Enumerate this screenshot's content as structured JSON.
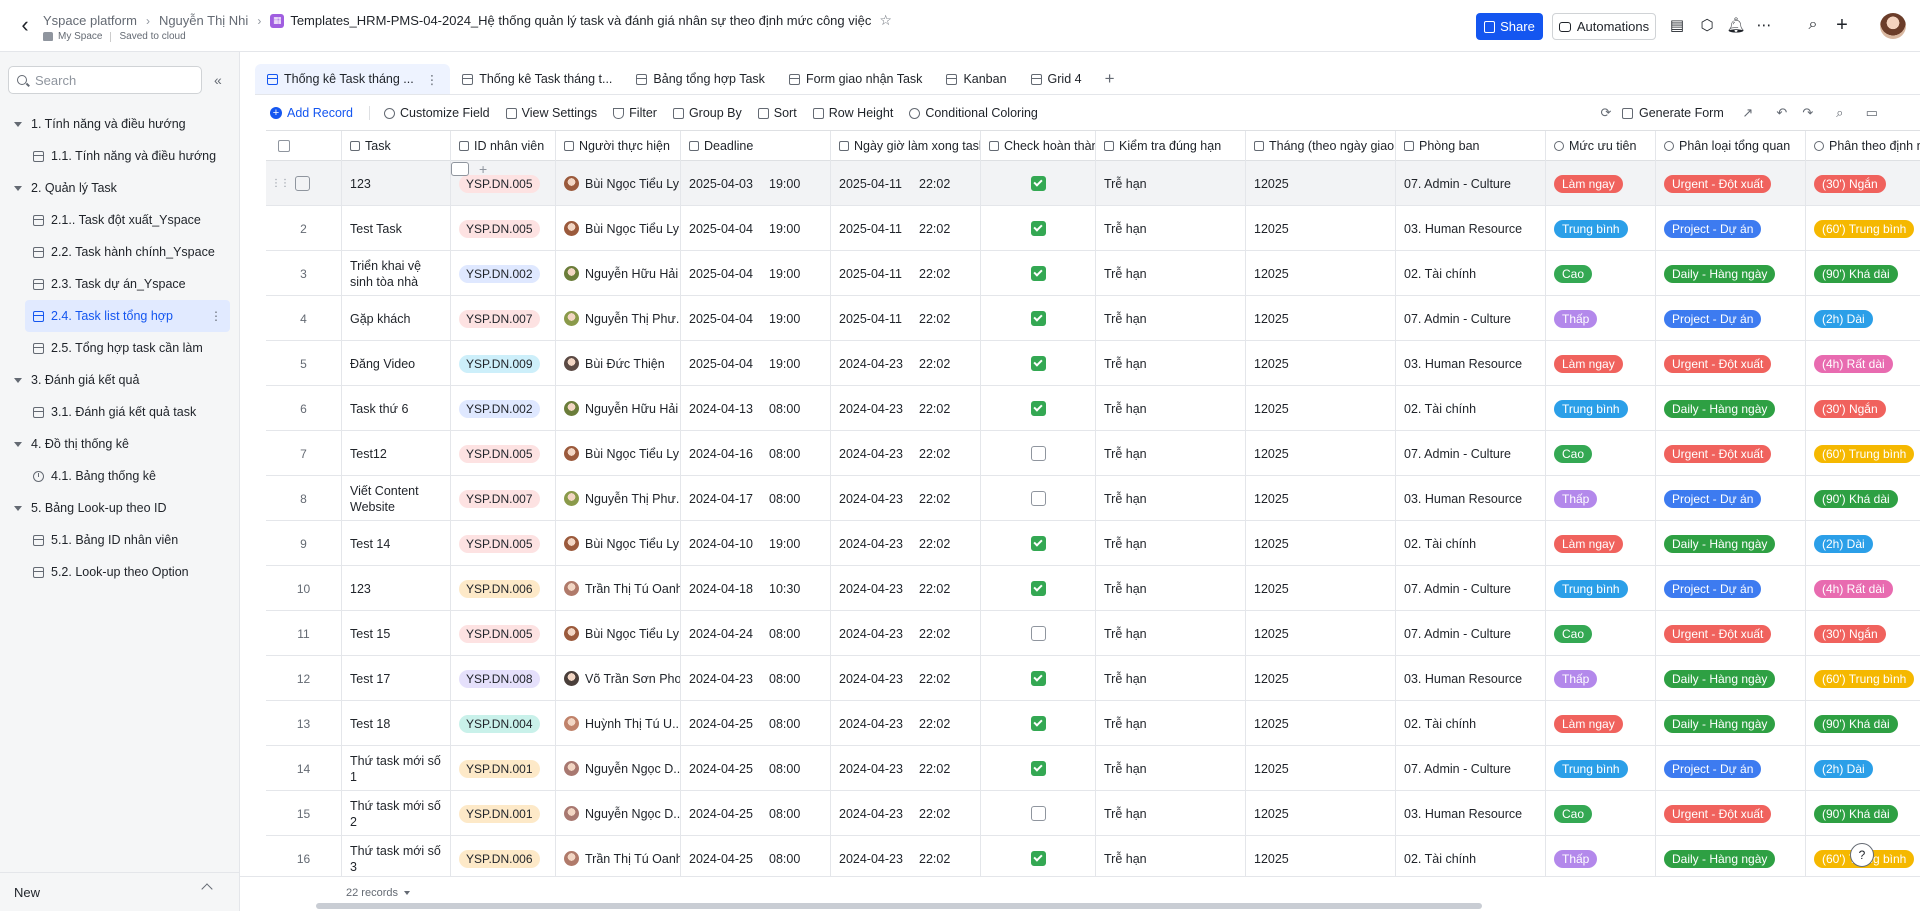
{
  "header": {
    "breadcrumbs": [
      "Yspace platform",
      "Nguyễn Thị Nhi"
    ],
    "doc_title": "Templates_HRM-PMS-04-2024_Hệ thống quản lý task và đánh giá nhân sự theo định mức công việc",
    "space": "My Space",
    "save_status": "Saved to cloud",
    "share_label": "Share",
    "automations_label": "Automations",
    "accent_color": "#1456f0"
  },
  "sidebar": {
    "search_placeholder": "Search",
    "groups": [
      {
        "label": "1. Tính năng và điều hướng",
        "items": [
          {
            "label": "1.1. Tính năng và điều hướng",
            "icon": "grid-icon"
          }
        ]
      },
      {
        "label": "2. Quản lý Task",
        "items": [
          {
            "label": "2.1.. Task đột xuất_Yspace",
            "icon": "grid-icon"
          },
          {
            "label": "2.2. Task hành chính_Yspace",
            "icon": "grid-icon"
          },
          {
            "label": "2.3. Task dự án_Yspace",
            "icon": "grid-icon"
          },
          {
            "label": "2.4. Task list tổng hợp",
            "icon": "grid-icon",
            "active": true
          },
          {
            "label": "2.5. Tổng hợp task cần làm",
            "icon": "grid-icon"
          }
        ]
      },
      {
        "label": "3. Đánh giá kết quả",
        "items": [
          {
            "label": "3.1. Đánh giá kết quả task",
            "icon": "grid-icon"
          }
        ]
      },
      {
        "label": "4. Đồ thị thống kê",
        "items": [
          {
            "label": "4.1. Bảng thống kê",
            "icon": "dashboard-icon"
          }
        ]
      },
      {
        "label": "5. Bảng Look-up theo ID",
        "items": [
          {
            "label": "5.1. Bảng ID nhân viên",
            "icon": "grid-icon"
          },
          {
            "label": "5.2. Look-up theo Option",
            "icon": "grid-icon"
          }
        ]
      }
    ],
    "footer_label": "New"
  },
  "tabs": [
    {
      "label": "Thống kê Task tháng ...",
      "active": true
    },
    {
      "label": "Thống kê Task tháng t..."
    },
    {
      "label": "Bảng tổng hợp Task"
    },
    {
      "label": "Form giao nhận Task"
    },
    {
      "label": "Kanban"
    },
    {
      "label": "Grid 4"
    }
  ],
  "toolbar": {
    "add_record": "Add Record",
    "customize_field": "Customize Field",
    "view_settings": "View Settings",
    "filter": "Filter",
    "group_by": "Group By",
    "sort": "Sort",
    "row_height": "Row Height",
    "conditional_coloring": "Conditional Coloring",
    "generate_form": "Generate Form"
  },
  "columns": {
    "task": "Task",
    "employee_id": "ID nhân viên",
    "assignee": "Người thực hiện",
    "deadline": "Deadline",
    "done_date": "Ngày giờ làm xong task",
    "check_done": "Check hoàn thành",
    "on_time": "Kiểm tra đúng hạn",
    "month": "Tháng (theo ngày giao t...",
    "department": "Phòng ban",
    "priority": "Mức ưu tiên",
    "category": "Phân loại tổng quan",
    "norm": "Phân theo định mứ"
  },
  "rows": [
    {
      "n": "1",
      "task": "123",
      "id": "YSP.DN.005",
      "person": "Bùi Ngọc Tiểu Ly",
      "dl_d": "2025-04-03",
      "dl_t": "19:00",
      "dn_d": "2025-04-11",
      "dn_t": "22:02",
      "done": true,
      "ontime": "Trễ hạn",
      "month": "12025",
      "dept": "07. Admin - Culture",
      "prio": "Làm ngay",
      "cat": "Urgent - Đột xuất",
      "norm": "(30') Ngắn"
    },
    {
      "n": "2",
      "task": "Test Task",
      "id": "YSP.DN.005",
      "person": "Bùi Ngọc Tiểu Ly",
      "dl_d": "2025-04-04",
      "dl_t": "19:00",
      "dn_d": "2025-04-11",
      "dn_t": "22:02",
      "done": true,
      "ontime": "Trễ hạn",
      "month": "12025",
      "dept": "03. Human Resource",
      "prio": "Trung bình",
      "cat": "Project - Dự án",
      "norm": "(60') Trung bình"
    },
    {
      "n": "3",
      "task": "Triển khai vệ sinh tòa nhà",
      "id": "YSP.DN.002",
      "person": "Nguyễn Hữu Hải",
      "dl_d": "2025-04-04",
      "dl_t": "19:00",
      "dn_d": "2025-04-11",
      "dn_t": "22:02",
      "done": true,
      "ontime": "Trễ hạn",
      "month": "12025",
      "dept": "02. Tài chính",
      "prio": "Cao",
      "cat": "Daily - Hàng ngày",
      "norm": "(90') Khá dài"
    },
    {
      "n": "4",
      "task": "Gặp khách",
      "id": "YSP.DN.007",
      "person": "Nguyễn Thị Phư...",
      "dl_d": "2025-04-04",
      "dl_t": "19:00",
      "dn_d": "2025-04-11",
      "dn_t": "22:02",
      "done": true,
      "ontime": "Trễ hạn",
      "month": "12025",
      "dept": "07. Admin - Culture",
      "prio": "Thấp",
      "cat": "Project - Dự án",
      "norm": "(2h) Dài"
    },
    {
      "n": "5",
      "task": "Đăng Video",
      "id": "YSP.DN.009",
      "person": "Bùi Đức Thiện",
      "dl_d": "2025-04-04",
      "dl_t": "19:00",
      "dn_d": "2024-04-23",
      "dn_t": "22:02",
      "done": true,
      "ontime": "Trễ hạn",
      "month": "12025",
      "dept": "03. Human Resource",
      "prio": "Làm ngay",
      "cat": "Urgent - Đột xuất",
      "norm": "(4h) Rất dài"
    },
    {
      "n": "6",
      "task": "Task thứ 6",
      "id": "YSP.DN.002",
      "person": "Nguyễn Hữu Hải",
      "dl_d": "2024-04-13",
      "dl_t": "08:00",
      "dn_d": "2024-04-23",
      "dn_t": "22:02",
      "done": true,
      "ontime": "Trễ hạn",
      "month": "12025",
      "dept": "02. Tài chính",
      "prio": "Trung bình",
      "cat": "Daily - Hàng ngày",
      "norm": "(30') Ngắn"
    },
    {
      "n": "7",
      "task": "Test12",
      "id": "YSP.DN.005",
      "person": "Bùi Ngọc Tiểu Ly",
      "dl_d": "2024-04-16",
      "dl_t": "08:00",
      "dn_d": "2024-04-23",
      "dn_t": "22:02",
      "done": false,
      "ontime": "Trễ hạn",
      "month": "12025",
      "dept": "07. Admin - Culture",
      "prio": "Cao",
      "cat": "Urgent - Đột xuất",
      "norm": "(60') Trung bình"
    },
    {
      "n": "8",
      "task": "Viết Content Website",
      "id": "YSP.DN.007",
      "person": "Nguyễn Thị Phư...",
      "dl_d": "2024-04-17",
      "dl_t": "08:00",
      "dn_d": "2024-04-23",
      "dn_t": "22:02",
      "done": false,
      "ontime": "Trễ hạn",
      "month": "12025",
      "dept": "03. Human Resource",
      "prio": "Thấp",
      "cat": "Project - Dự án",
      "norm": "(90') Khá dài"
    },
    {
      "n": "9",
      "task": "Test 14",
      "id": "YSP.DN.005",
      "person": "Bùi Ngọc Tiểu Ly",
      "dl_d": "2024-04-10",
      "dl_t": "19:00",
      "dn_d": "2024-04-23",
      "dn_t": "22:02",
      "done": true,
      "ontime": "Trễ hạn",
      "month": "12025",
      "dept": "02. Tài chính",
      "prio": "Làm ngay",
      "cat": "Daily - Hàng ngày",
      "norm": "(2h) Dài"
    },
    {
      "n": "10",
      "task": "123",
      "id": "YSP.DN.006",
      "person": "Trần Thị Tú Oanh",
      "dl_d": "2024-04-18",
      "dl_t": "10:30",
      "dn_d": "2024-04-23",
      "dn_t": "22:02",
      "done": true,
      "ontime": "Trễ hạn",
      "month": "12025",
      "dept": "07. Admin - Culture",
      "prio": "Trung bình",
      "cat": "Project - Dự án",
      "norm": "(4h) Rất dài"
    },
    {
      "n": "11",
      "task": "Test 15",
      "id": "YSP.DN.005",
      "person": "Bùi Ngọc Tiểu Ly",
      "dl_d": "2024-04-24",
      "dl_t": "08:00",
      "dn_d": "2024-04-23",
      "dn_t": "22:02",
      "done": false,
      "ontime": "Trễ hạn",
      "month": "12025",
      "dept": "07. Admin - Culture",
      "prio": "Cao",
      "cat": "Urgent - Đột xuất",
      "norm": "(30') Ngắn"
    },
    {
      "n": "12",
      "task": "Test 17",
      "id": "YSP.DN.008",
      "person": "Võ Trần Sơn Pho...",
      "dl_d": "2024-04-23",
      "dl_t": "08:00",
      "dn_d": "2024-04-23",
      "dn_t": "22:02",
      "done": true,
      "ontime": "Trễ hạn",
      "month": "12025",
      "dept": "03. Human Resource",
      "prio": "Thấp",
      "cat": "Daily - Hàng ngày",
      "norm": "(60') Trung bình"
    },
    {
      "n": "13",
      "task": "Test 18",
      "id": "YSP.DN.004",
      "person": "Huỳnh Thị Tú U...",
      "dl_d": "2024-04-25",
      "dl_t": "08:00",
      "dn_d": "2024-04-23",
      "dn_t": "22:02",
      "done": true,
      "ontime": "Trễ hạn",
      "month": "12025",
      "dept": "02. Tài chính",
      "prio": "Làm ngay",
      "cat": "Daily - Hàng ngày",
      "norm": "(90') Khá dài"
    },
    {
      "n": "14",
      "task": "Thứ task mới số 1",
      "id": "YSP.DN.001",
      "person": "Nguyễn Ngọc D...",
      "dl_d": "2024-04-25",
      "dl_t": "08:00",
      "dn_d": "2024-04-23",
      "dn_t": "22:02",
      "done": true,
      "ontime": "Trễ hạn",
      "month": "12025",
      "dept": "07. Admin - Culture",
      "prio": "Trung bình",
      "cat": "Project - Dự án",
      "norm": "(2h) Dài"
    },
    {
      "n": "15",
      "task": "Thứ task mới số 2",
      "id": "YSP.DN.001",
      "person": "Nguyễn Ngọc D...",
      "dl_d": "2024-04-25",
      "dl_t": "08:00",
      "dn_d": "2024-04-23",
      "dn_t": "22:02",
      "done": false,
      "ontime": "Trễ hạn",
      "month": "12025",
      "dept": "03. Human Resource",
      "prio": "Cao",
      "cat": "Urgent - Đột xuất",
      "norm": "(90') Khá dài"
    },
    {
      "n": "16",
      "task": "Thứ task mới số 3",
      "id": "YSP.DN.006",
      "person": "Trần Thị Tú Oanh",
      "dl_d": "2024-04-25",
      "dl_t": "08:00",
      "dn_d": "2024-04-23",
      "dn_t": "22:02",
      "done": true,
      "ontime": "Trễ hạn",
      "month": "12025",
      "dept": "02. Tài chính",
      "prio": "Thấp",
      "cat": "Daily - Hàng ngày",
      "norm": "(60') Trung bình"
    }
  ],
  "colors": {
    "priority": {
      "Làm ngay": "#f0625d",
      "Trung bình": "#2b9fe8",
      "Cao": "#34a853",
      "Thấp": "#b388eb"
    },
    "category": {
      "Urgent - Đột xuất": "#f0625d",
      "Project - Dự án": "#3d7bf0",
      "Daily - Hàng ngày": "#2ea043"
    },
    "norm": {
      "(30') Ngắn": "#f0625d",
      "(60') Trung bình": "#f5b800",
      "(90') Khá dài": "#2ea043",
      "(2h) Dài": "#2b9fe8",
      "(4h) Rất dài": "#e86bb0"
    },
    "id_tag": {
      "YSP.DN.005": "#fde2e2",
      "YSP.DN.002": "#dfe8ff",
      "YSP.DN.007": "#fde2e2",
      "YSP.DN.009": "#cdeffa",
      "YSP.DN.006": "#fde9c8",
      "YSP.DN.008": "#e5e0fb",
      "YSP.DN.004": "#c9f1ea",
      "YSP.DN.001": "#fde9c8"
    },
    "person": {
      "Bùi Ngọc Tiểu Ly": "#9b5a3c",
      "Nguyễn Hữu Hải": "#6b7d3a",
      "Nguyễn Thị Phư...": "#8a9a4a",
      "Bùi Đức Thiện": "#5b4a44",
      "Trần Thị Tú Oanh": "#b07a6a",
      "Võ Trần Sơn Pho...": "#4a3f3a",
      "Huỳnh Thị Tú U...": "#c0826a",
      "Nguyễn Ngọc D...": "#a87870"
    }
  },
  "status": {
    "records": "22 records"
  }
}
